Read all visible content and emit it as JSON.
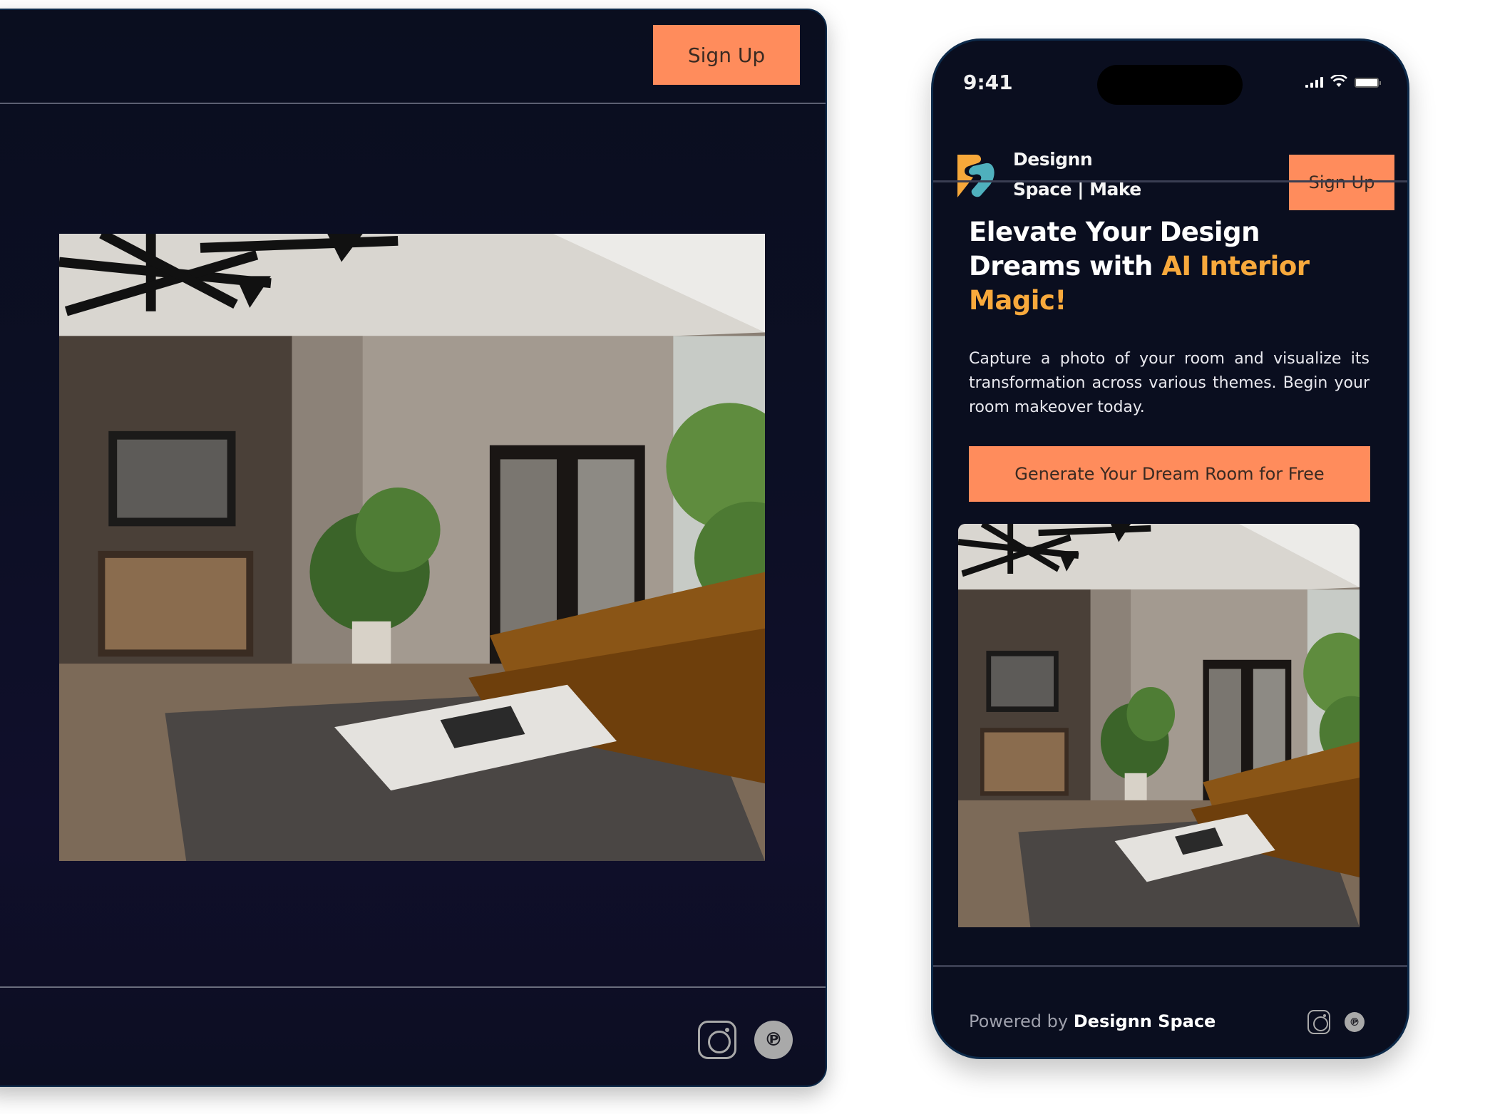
{
  "colors": {
    "background": "#0a0e1f",
    "accent_button": "#ff8c5c",
    "accent_text": "#f8a93c",
    "logo_orange": "#f7a83a",
    "logo_teal": "#4fb0bd",
    "icon_gray": "#a9a9a9"
  },
  "desktop": {
    "header": {
      "signup_label": "Sign Up"
    },
    "hero_image": {
      "alt": "Modern living room interior with ceiling chandelier, leather sofa, plant and coffee table"
    },
    "footer": {
      "social": [
        {
          "name": "instagram",
          "icon": "instagram-icon"
        },
        {
          "name": "pinterest",
          "icon": "pinterest-icon",
          "glyph": "℗"
        }
      ]
    }
  },
  "phone": {
    "status_bar": {
      "time": "9:41",
      "icons": [
        "signal-icon",
        "wifi-icon",
        "battery-icon"
      ]
    },
    "header": {
      "brand_line1": "Designn",
      "brand_line2": "Space | Make",
      "signup_label": "Sign Up"
    },
    "hero": {
      "headline_part1": "Elevate Your Design Dreams with ",
      "headline_accent": "AI Interior Magic!",
      "description": "Capture a photo of your room and visualize its transformation across various themes. Begin your room makeover today.",
      "cta_label": "Generate Your Dream Room for Free"
    },
    "hero_image": {
      "alt": "Modern living room interior preview"
    },
    "footer": {
      "powered_by_prefix": "Powered by",
      "powered_by_brand": "Designn Space",
      "social": [
        {
          "name": "instagram",
          "icon": "instagram-icon"
        },
        {
          "name": "pinterest",
          "icon": "pinterest-icon",
          "glyph": "℗"
        }
      ]
    }
  }
}
